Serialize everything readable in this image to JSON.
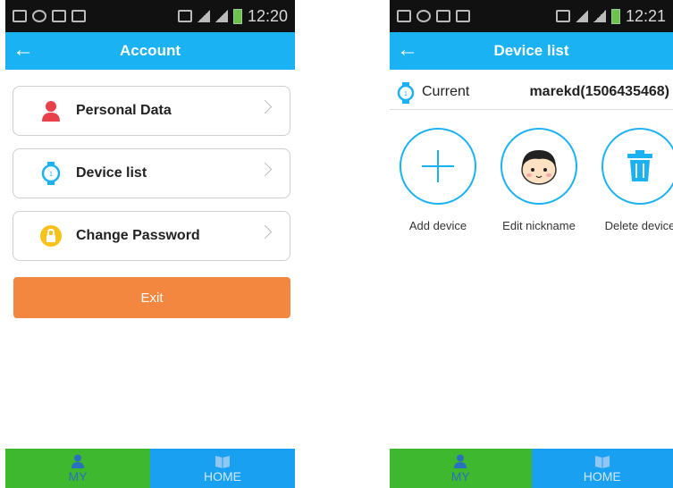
{
  "left": {
    "status": {
      "time": "12:20"
    },
    "title": "Account",
    "menu": [
      {
        "label": "Personal Data",
        "icon": "person-icon"
      },
      {
        "label": "Device list",
        "icon": "watch-icon"
      },
      {
        "label": "Change Password",
        "icon": "lock-icon"
      }
    ],
    "exit_label": "Exit",
    "tabs": [
      {
        "label": "MY"
      },
      {
        "label": "HOME"
      }
    ]
  },
  "right": {
    "status": {
      "time": "12:21"
    },
    "title": "Device list",
    "current": {
      "label": "Current",
      "value": "marekd(1506435468)"
    },
    "actions": [
      {
        "label": "Add device",
        "icon": "plus-icon"
      },
      {
        "label": "Edit nickname",
        "icon": "face-icon"
      },
      {
        "label": "Delete device",
        "icon": "trash-icon"
      }
    ],
    "tabs": [
      {
        "label": "MY"
      },
      {
        "label": "HOME"
      }
    ]
  },
  "colors": {
    "accent_blue": "#1ab2f2",
    "exit_orange": "#f4873f",
    "tab_green": "#3eb82e",
    "tab_blue": "#1aa0f0"
  }
}
